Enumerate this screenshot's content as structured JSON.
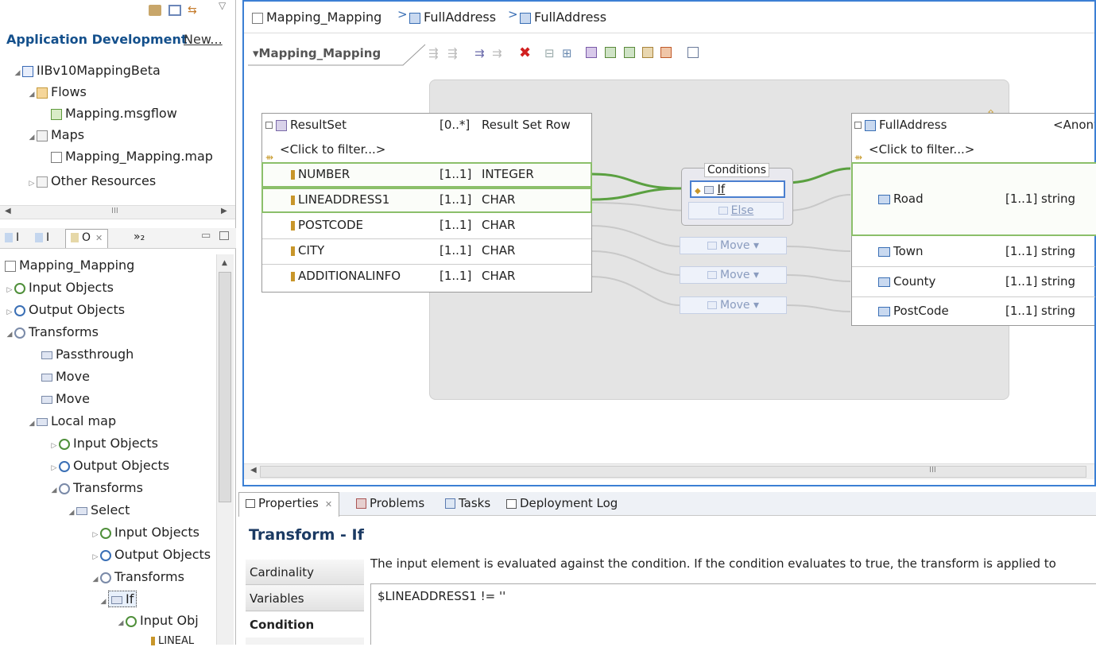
{
  "left_panel": {
    "title": "Application Development",
    "new_link": "New...",
    "tree": [
      {
        "label": "IIBv10MappingBeta"
      },
      {
        "label": "Flows"
      },
      {
        "label": "Mapping.msgflow"
      },
      {
        "label": "Maps"
      },
      {
        "label": "Mapping_Mapping.map"
      },
      {
        "label": "Other Resources"
      }
    ],
    "scroll_glyph": "III"
  },
  "outline": {
    "tabs": [
      "I",
      "I",
      "O",
      "»₂"
    ],
    "tree": [
      {
        "label": "Mapping_Mapping"
      },
      {
        "label": "Input Objects"
      },
      {
        "label": "Output Objects"
      },
      {
        "label": "Transforms"
      },
      {
        "label": "Passthrough"
      },
      {
        "label": "Move"
      },
      {
        "label": "Move"
      },
      {
        "label": "Local map"
      },
      {
        "label": "Input Objects"
      },
      {
        "label": "Output Objects"
      },
      {
        "label": "Transforms"
      },
      {
        "label": "Select"
      },
      {
        "label": "Input Objects"
      },
      {
        "label": "Output Objects"
      },
      {
        "label": "Transforms"
      },
      {
        "label": "If"
      },
      {
        "label": "Input Obj"
      },
      {
        "label": "LINEAL"
      }
    ]
  },
  "editor": {
    "breadcrumb": [
      "Mapping_Mapping",
      "FullAddress",
      "FullAddress"
    ],
    "map_tab": "Mapping_Mapping",
    "input": {
      "name": "ResultSet",
      "card": "[0..*]",
      "type": "Result Set Row",
      "filter": "<Click to filter...>",
      "rows": [
        {
          "name": "NUMBER",
          "card": "[1..1]",
          "type": "INTEGER"
        },
        {
          "name": "LINEADDRESS1",
          "card": "[1..1]",
          "type": "CHAR"
        },
        {
          "name": "POSTCODE",
          "card": "[1..1]",
          "type": "CHAR"
        },
        {
          "name": "CITY",
          "card": "[1..1]",
          "type": "CHAR"
        },
        {
          "name": "ADDITIONALINFO",
          "card": "[1..1]",
          "type": "CHAR"
        }
      ]
    },
    "output": {
      "name": "FullAddress",
      "type": "<Anonyr",
      "filter": "<Click to filter...>",
      "rows": [
        {
          "name": "Road",
          "card": "[1..1]",
          "type": "string"
        },
        {
          "name": "Town",
          "card": "[1..1]",
          "type": "string"
        },
        {
          "name": "County",
          "card": "[1..1]",
          "type": "string"
        },
        {
          "name": "PostCode",
          "card": "[1..1]",
          "type": "string"
        }
      ]
    },
    "conditions": {
      "title": "Conditions",
      "if": "If",
      "else": "Else"
    },
    "moves": [
      "Move",
      "Move",
      "Move"
    ],
    "scroll_glyph": "III"
  },
  "bottom": {
    "tabs": [
      "Properties",
      "Problems",
      "Tasks",
      "Deployment Log"
    ],
    "title": "Transform - If",
    "side_tabs": [
      "Cardinality",
      "Variables",
      "Condition"
    ],
    "description": "The input element is evaluated against the condition. If the condition evaluates to true, the transform is applied to",
    "condition": "$LINEADDRESS1 != ''"
  }
}
